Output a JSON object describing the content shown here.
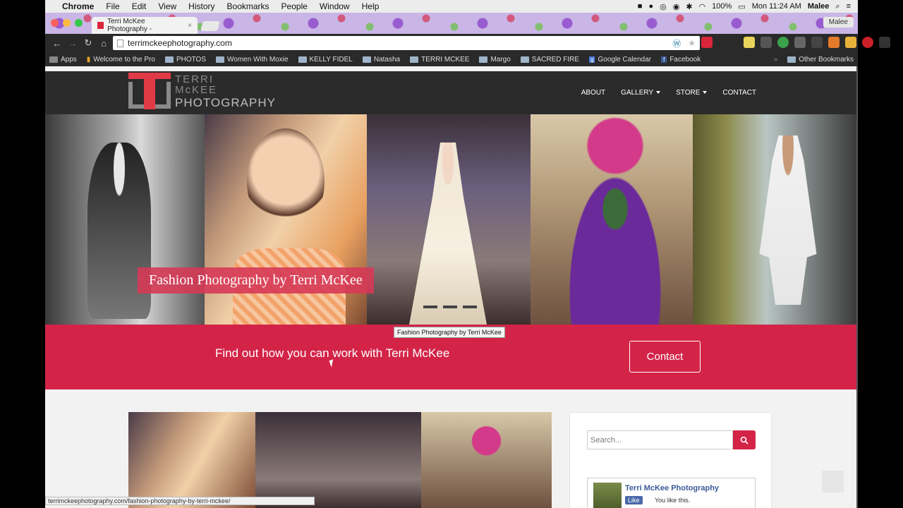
{
  "menubar": {
    "app": "Chrome",
    "items": [
      "File",
      "Edit",
      "View",
      "History",
      "Bookmarks",
      "People",
      "Window",
      "Help"
    ],
    "battery": "100%",
    "clock": "Mon 11:24 AM",
    "user": "Malee"
  },
  "browser": {
    "tab_title": "Terri McKee Photography -",
    "profile": "Malee",
    "url": "terrimckeephotography.com",
    "bookmarks": [
      "Apps",
      "Welcome to the Pro",
      "PHOTOS",
      "Women With Moxie",
      "KELLY FIDEL",
      "Natasha",
      "TERRI MCKEE",
      "Margo",
      "SACRED FIRE",
      "Google Calendar",
      "Facebook"
    ],
    "other_bookmarks": "Other Bookmarks"
  },
  "site": {
    "logo": {
      "line1": "TERRI",
      "line2": "McKEE",
      "line3": "PHOTOGRAPHY"
    },
    "nav": {
      "about": "ABOUT",
      "gallery": "GALLERY",
      "store": "STORE",
      "contact": "CONTACT"
    },
    "hero_caption": "Fashion Photography by Terri McKee",
    "tooltip": "Fashion Photography by Terri McKee",
    "cta_text": "Find out how you can work with Terri McKee",
    "cta_button": "Contact",
    "search_placeholder": "Search...",
    "fb": {
      "name": "Terri McKee Photography",
      "like": "Like",
      "you_like": "You like this."
    }
  },
  "status_url": "terrimckeephotography.com/fashion-photography-by-terri-mckee/",
  "colors": {
    "accent": "#d32448",
    "header": "#2b2b2b"
  }
}
